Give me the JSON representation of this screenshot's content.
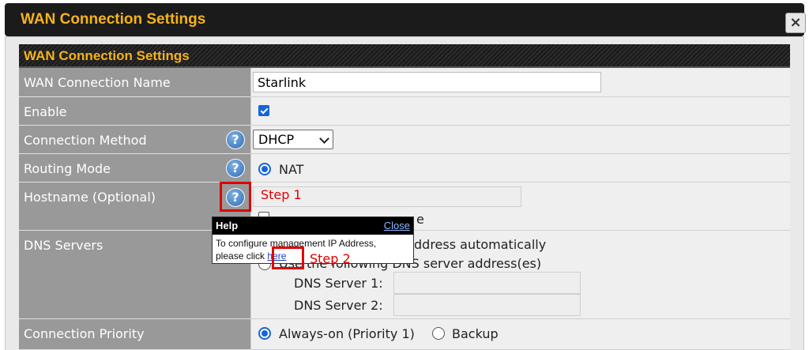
{
  "dialog": {
    "title": "WAN Connection Settings",
    "close_glyph": "×"
  },
  "section": {
    "header": "WAN Connection Settings"
  },
  "rows": {
    "wan_name": {
      "label": "WAN Connection Name",
      "value": "Starlink"
    },
    "enable": {
      "label": "Enable",
      "checked": true
    },
    "connection_method": {
      "label": "Connection Method",
      "selected": "DHCP"
    },
    "routing_mode": {
      "label": "Routing Mode",
      "option": "NAT"
    },
    "hostname": {
      "label": "Hostname (Optional)",
      "checkbox_label_tail": "e"
    },
    "dns": {
      "label": "DNS Servers",
      "option1_tail": "ddress automatically",
      "option2_text": "Use the following DNS server address(es)",
      "server1_label": "DNS Server 1:",
      "server2_label": "DNS Server 2:"
    },
    "priority": {
      "label": "Connection Priority",
      "option1": "Always-on (Priority 1)",
      "option2": "Backup"
    }
  },
  "help_glyph": "?",
  "popup": {
    "title": "Help",
    "close": "Close",
    "line1": "To configure management IP Address,",
    "line2_prefix": "please click ",
    "link": "here"
  },
  "annotations": {
    "step1": "Step 1",
    "step2": "Step 2",
    "color": "#e00000"
  },
  "colors": {
    "accent": "#f5b31a",
    "label_bg": "#999999",
    "help_blue": "#2f6db3"
  }
}
